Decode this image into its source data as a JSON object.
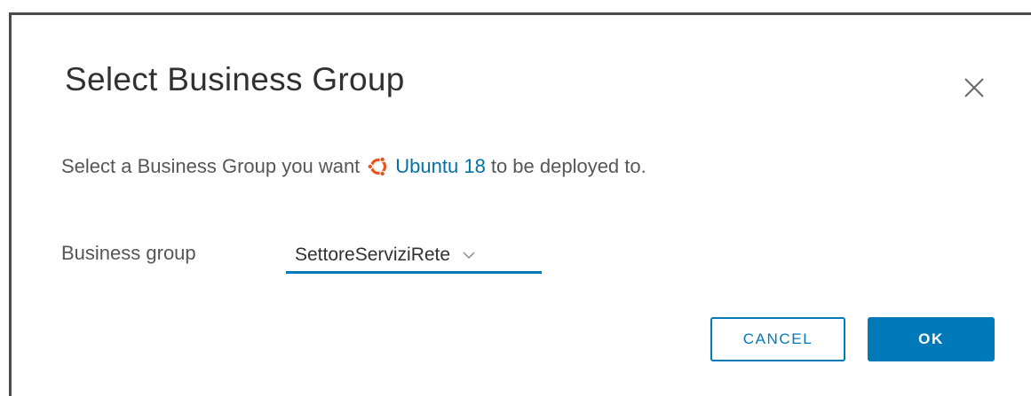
{
  "dialog": {
    "title": "Select Business Group",
    "description_prefix": "Select a Business Group you want",
    "catalog_item": "Ubuntu 18",
    "description_suffix": "to be deployed to.",
    "field_label": "Business group",
    "selected_group": "SettoreServiziRete",
    "cancel_label": "CANCEL",
    "ok_label": "OK",
    "icons": {
      "close": "close-icon",
      "logo": "ubuntu-logo-icon",
      "dropdown": "chevron-down-icon"
    },
    "colors": {
      "accent": "#0079b8",
      "link": "#0072a3",
      "ubuntu_orange": "#e95420"
    }
  }
}
